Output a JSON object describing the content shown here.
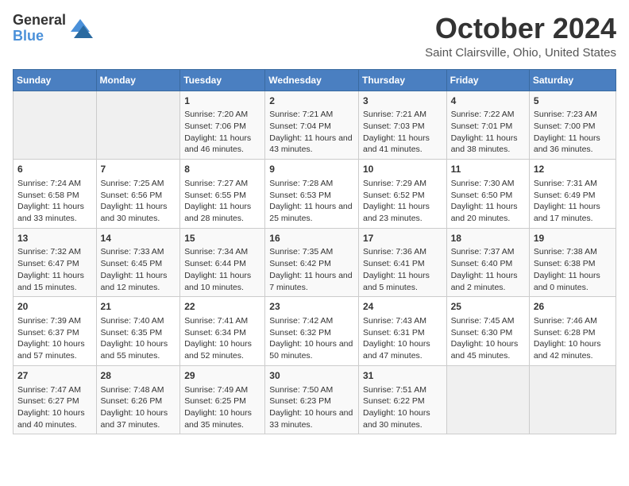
{
  "header": {
    "logo_line1": "General",
    "logo_line2": "Blue",
    "month": "October 2024",
    "location": "Saint Clairsville, Ohio, United States"
  },
  "weekdays": [
    "Sunday",
    "Monday",
    "Tuesday",
    "Wednesday",
    "Thursday",
    "Friday",
    "Saturday"
  ],
  "weeks": [
    [
      {
        "day": "",
        "info": ""
      },
      {
        "day": "",
        "info": ""
      },
      {
        "day": "1",
        "info": "Sunrise: 7:20 AM\nSunset: 7:06 PM\nDaylight: 11 hours and 46 minutes."
      },
      {
        "day": "2",
        "info": "Sunrise: 7:21 AM\nSunset: 7:04 PM\nDaylight: 11 hours and 43 minutes."
      },
      {
        "day": "3",
        "info": "Sunrise: 7:21 AM\nSunset: 7:03 PM\nDaylight: 11 hours and 41 minutes."
      },
      {
        "day": "4",
        "info": "Sunrise: 7:22 AM\nSunset: 7:01 PM\nDaylight: 11 hours and 38 minutes."
      },
      {
        "day": "5",
        "info": "Sunrise: 7:23 AM\nSunset: 7:00 PM\nDaylight: 11 hours and 36 minutes."
      }
    ],
    [
      {
        "day": "6",
        "info": "Sunrise: 7:24 AM\nSunset: 6:58 PM\nDaylight: 11 hours and 33 minutes."
      },
      {
        "day": "7",
        "info": "Sunrise: 7:25 AM\nSunset: 6:56 PM\nDaylight: 11 hours and 30 minutes."
      },
      {
        "day": "8",
        "info": "Sunrise: 7:27 AM\nSunset: 6:55 PM\nDaylight: 11 hours and 28 minutes."
      },
      {
        "day": "9",
        "info": "Sunrise: 7:28 AM\nSunset: 6:53 PM\nDaylight: 11 hours and 25 minutes."
      },
      {
        "day": "10",
        "info": "Sunrise: 7:29 AM\nSunset: 6:52 PM\nDaylight: 11 hours and 23 minutes."
      },
      {
        "day": "11",
        "info": "Sunrise: 7:30 AM\nSunset: 6:50 PM\nDaylight: 11 hours and 20 minutes."
      },
      {
        "day": "12",
        "info": "Sunrise: 7:31 AM\nSunset: 6:49 PM\nDaylight: 11 hours and 17 minutes."
      }
    ],
    [
      {
        "day": "13",
        "info": "Sunrise: 7:32 AM\nSunset: 6:47 PM\nDaylight: 11 hours and 15 minutes."
      },
      {
        "day": "14",
        "info": "Sunrise: 7:33 AM\nSunset: 6:45 PM\nDaylight: 11 hours and 12 minutes."
      },
      {
        "day": "15",
        "info": "Sunrise: 7:34 AM\nSunset: 6:44 PM\nDaylight: 11 hours and 10 minutes."
      },
      {
        "day": "16",
        "info": "Sunrise: 7:35 AM\nSunset: 6:42 PM\nDaylight: 11 hours and 7 minutes."
      },
      {
        "day": "17",
        "info": "Sunrise: 7:36 AM\nSunset: 6:41 PM\nDaylight: 11 hours and 5 minutes."
      },
      {
        "day": "18",
        "info": "Sunrise: 7:37 AM\nSunset: 6:40 PM\nDaylight: 11 hours and 2 minutes."
      },
      {
        "day": "19",
        "info": "Sunrise: 7:38 AM\nSunset: 6:38 PM\nDaylight: 11 hours and 0 minutes."
      }
    ],
    [
      {
        "day": "20",
        "info": "Sunrise: 7:39 AM\nSunset: 6:37 PM\nDaylight: 10 hours and 57 minutes."
      },
      {
        "day": "21",
        "info": "Sunrise: 7:40 AM\nSunset: 6:35 PM\nDaylight: 10 hours and 55 minutes."
      },
      {
        "day": "22",
        "info": "Sunrise: 7:41 AM\nSunset: 6:34 PM\nDaylight: 10 hours and 52 minutes."
      },
      {
        "day": "23",
        "info": "Sunrise: 7:42 AM\nSunset: 6:32 PM\nDaylight: 10 hours and 50 minutes."
      },
      {
        "day": "24",
        "info": "Sunrise: 7:43 AM\nSunset: 6:31 PM\nDaylight: 10 hours and 47 minutes."
      },
      {
        "day": "25",
        "info": "Sunrise: 7:45 AM\nSunset: 6:30 PM\nDaylight: 10 hours and 45 minutes."
      },
      {
        "day": "26",
        "info": "Sunrise: 7:46 AM\nSunset: 6:28 PM\nDaylight: 10 hours and 42 minutes."
      }
    ],
    [
      {
        "day": "27",
        "info": "Sunrise: 7:47 AM\nSunset: 6:27 PM\nDaylight: 10 hours and 40 minutes."
      },
      {
        "day": "28",
        "info": "Sunrise: 7:48 AM\nSunset: 6:26 PM\nDaylight: 10 hours and 37 minutes."
      },
      {
        "day": "29",
        "info": "Sunrise: 7:49 AM\nSunset: 6:25 PM\nDaylight: 10 hours and 35 minutes."
      },
      {
        "day": "30",
        "info": "Sunrise: 7:50 AM\nSunset: 6:23 PM\nDaylight: 10 hours and 33 minutes."
      },
      {
        "day": "31",
        "info": "Sunrise: 7:51 AM\nSunset: 6:22 PM\nDaylight: 10 hours and 30 minutes."
      },
      {
        "day": "",
        "info": ""
      },
      {
        "day": "",
        "info": ""
      }
    ]
  ]
}
